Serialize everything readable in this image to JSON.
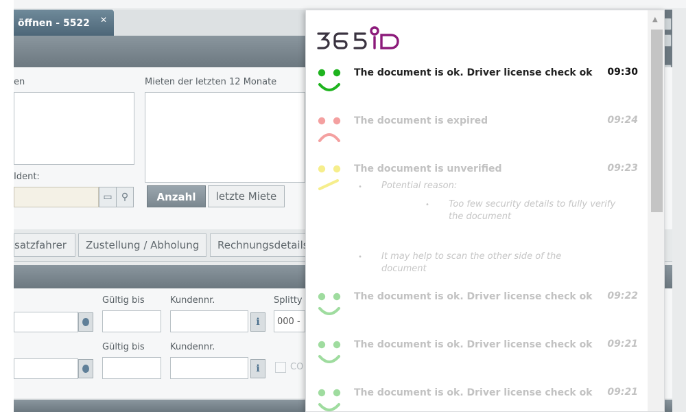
{
  "app": {
    "document_tab": "öffnen - 5522",
    "document_tab_close": "✕"
  },
  "form": {
    "label_left_top": "en",
    "label_rentals": "Mieten der letzten 12 Monate",
    "label_ident": "Ident:",
    "btn_anzahl": "Anzahl",
    "btn_letzte_miete": "letzte Miete",
    "tabs": [
      "satzfahrer",
      "Zustellung / Abholung",
      "Rechnungsdetails"
    ],
    "row1": {
      "gueltig_bis": "Gültig bis",
      "kundennr": "Kundennr.",
      "splitty": "Splitty",
      "splitty_value": "000 -"
    },
    "row2": {
      "gueltig_bis": "Gültig bis",
      "kundennr": "Kundennr.",
      "checkbox_label": "CO"
    },
    "info_icon_text": "i"
  },
  "notifications": {
    "logo": "365ID",
    "entries": [
      {
        "status": "ok",
        "text": "The document is ok. Driver license check ok",
        "time": "09:30",
        "active": true
      },
      {
        "status": "expired",
        "text": "The document is expired",
        "time": "09:24",
        "active": false
      },
      {
        "status": "unverified",
        "text": "The document is unverified",
        "time": "09:23",
        "active": false
      },
      {
        "status": "ok",
        "text": "The document is ok. Driver license check ok",
        "time": "09:22",
        "active": false
      },
      {
        "status": "ok",
        "text": "The document is ok. Driver license check ok",
        "time": "09:21",
        "active": false
      },
      {
        "status": "ok",
        "text": "The document is ok. Driver license check ok",
        "time": "09:21",
        "active": false
      }
    ],
    "unverified_details": {
      "label": "Potential reason:",
      "detail": "Too few security details to fully verify the document",
      "help": "It may help to scan the other side of the document"
    },
    "colors": {
      "ok": "#1fb41f",
      "expired": "#f4a0a0",
      "unverified": "#f6ee8c",
      "ok_faded": "#9fdc9f"
    }
  }
}
